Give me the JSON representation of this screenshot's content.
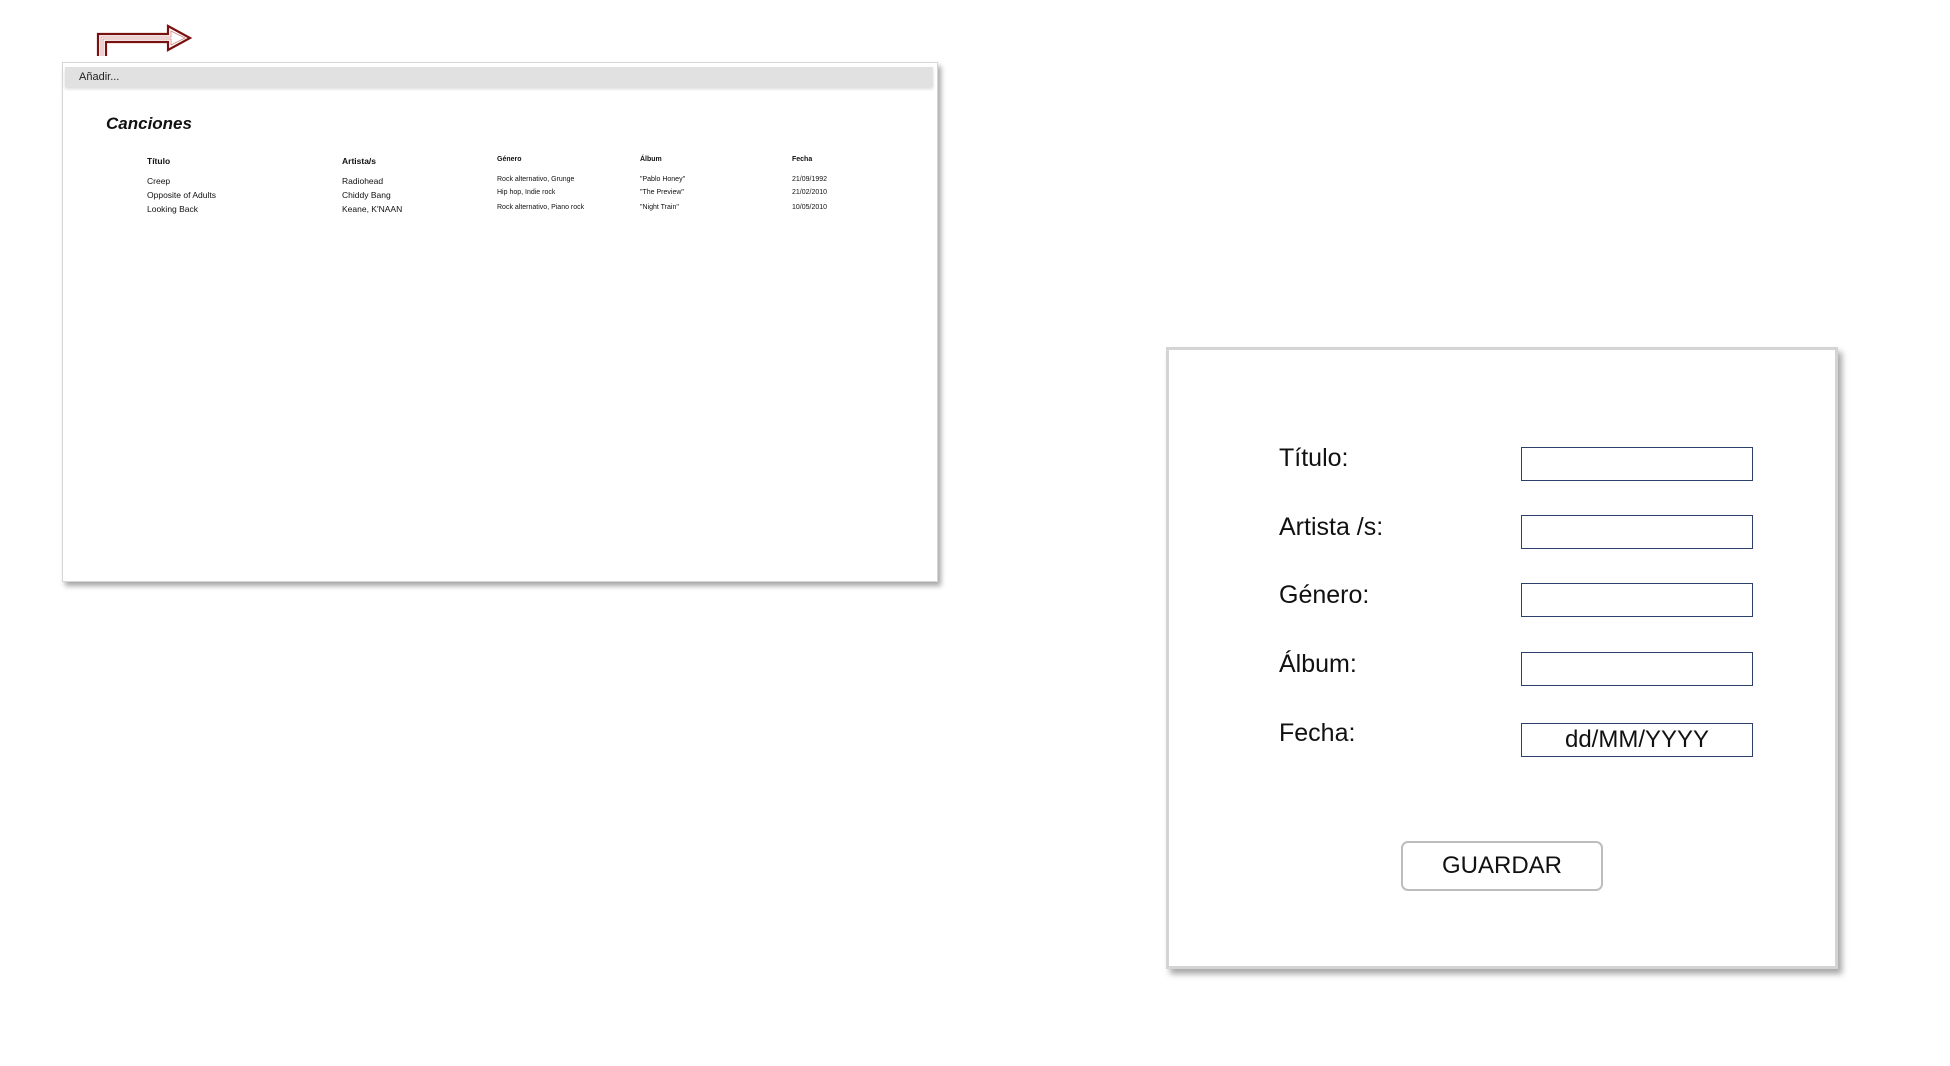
{
  "list_window": {
    "menu_add_label": "Añadir...",
    "title": "Canciones",
    "columns": [
      "Título",
      "Artista/s",
      "Género",
      "Álbum",
      "Fecha"
    ],
    "rows": [
      [
        "Creep",
        "Radiohead",
        "Rock alternativo, Grunge",
        "\"Pablo Honey\"",
        "21/09/1992"
      ],
      [
        "Opposite of Adults",
        "Chiddy Bang",
        "Hip hop, Indie rock",
        "\"The Preview\"",
        "21/02/2010"
      ],
      [
        "Looking Back",
        "Keane, K'NAAN",
        "Rock alternativo, Piano rock",
        "\"Night Train\"",
        "10/05/2010"
      ]
    ]
  },
  "form": {
    "titulo_label": "Título:",
    "artista_label": "Artista /s:",
    "genero_label": "Género:",
    "album_label": "Álbum:",
    "fecha_label": "Fecha:",
    "titulo_value": "",
    "artista_value": "",
    "genero_value": "",
    "album_value": "",
    "fecha_placeholder": "dd/MM/YYYY",
    "save_label": "GUARDAR"
  },
  "colors": {
    "arrow": "#7a1010",
    "input_border": "#2d3f6b",
    "menubar": "#e1e1e1"
  },
  "icons": {
    "navigation_arrow": "right-arrow-icon"
  }
}
